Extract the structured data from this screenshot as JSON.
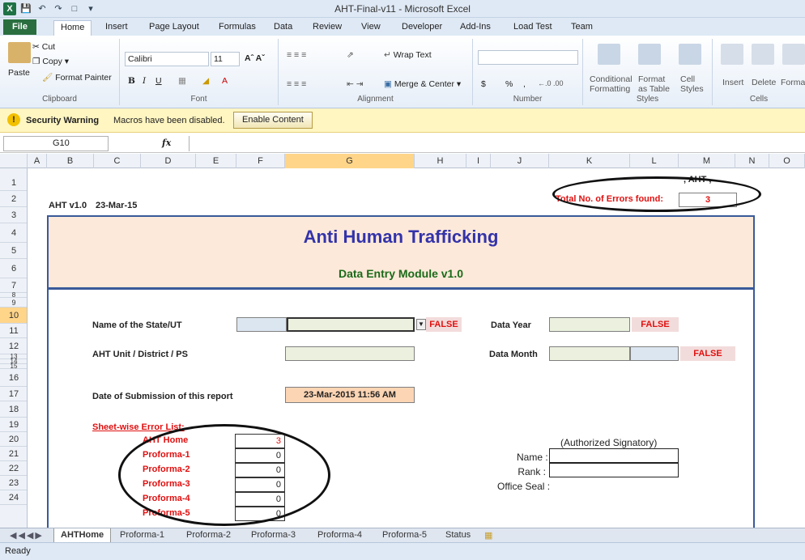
{
  "window": {
    "title": "AHT-Final-v11 - Microsoft Excel"
  },
  "ribbon": {
    "tabs": [
      "File",
      "Home",
      "Insert",
      "Page Layout",
      "Formulas",
      "Data",
      "Review",
      "View",
      "Developer",
      "Add-Ins",
      "Load Test",
      "Team"
    ],
    "active_tab": "Home",
    "clipboard": {
      "paste": "Paste",
      "cut": "Cut",
      "copy": "Copy",
      "format_painter": "Format Painter",
      "label": "Clipboard"
    },
    "font": {
      "name": "Calibri",
      "size": "11",
      "label": "Font"
    },
    "alignment": {
      "wrap": "Wrap Text",
      "merge": "Merge & Center",
      "label": "Alignment"
    },
    "number": {
      "label": "Number",
      "currency": "$",
      "percent": "%",
      "comma": ","
    },
    "styles": {
      "conditional": "Conditional",
      "conditional2": "Formatting",
      "format": "Format",
      "format2": "as Table",
      "cell": "Cell",
      "cell2": "Styles",
      "label": "Styles"
    },
    "cells": {
      "insert": "Insert",
      "delete": "Delete",
      "format": "Forma",
      "label": "Cells"
    }
  },
  "security": {
    "title": "Security Warning",
    "message": "Macros have been disabled.",
    "button": "Enable Content"
  },
  "formula_bar": {
    "name_box": "G10",
    "fx": "fx",
    "value": ""
  },
  "columns": [
    "A",
    "B",
    "C",
    "D",
    "E",
    "F",
    "G",
    "H",
    "I",
    "J",
    "K",
    "L",
    "M",
    "N",
    "O"
  ],
  "selected_column": "G",
  "rows": [
    "1",
    "2",
    "3",
    "4",
    "5",
    "6",
    "7",
    "8",
    "9",
    "10",
    "11",
    "12",
    "13",
    "14",
    "15",
    "16",
    "17",
    "18",
    "19",
    "20",
    "21",
    "22",
    "23",
    "24"
  ],
  "selected_row": "10",
  "sheet": {
    "corner_text": ", AHT-,",
    "version": "AHT v1.0",
    "version_date": "23-Mar-15",
    "total_errors_label": "Total No. of Errors found:",
    "total_errors_value": "3",
    "title": "Anti Human Trafficking",
    "subtitle": "Data Entry Module v1.0",
    "state_label": "Name of the State/UT",
    "state_value": "",
    "state_error": "FALSE",
    "unit_label": "AHT Unit / District / PS",
    "unit_value": "",
    "data_year_label": "Data Year",
    "data_year_error": "FALSE",
    "data_month_label": "Data Month",
    "data_month_error": "FALSE",
    "submission_label": "Date of Submission of this report",
    "submission_value": "23-Mar-2015  11:56 AM",
    "error_list_title": "Sheet-wise Error List:",
    "error_list": [
      {
        "name": "AHT Home",
        "count": "3"
      },
      {
        "name": "Proforma-1",
        "count": "0"
      },
      {
        "name": "Proforma-2",
        "count": "0"
      },
      {
        "name": "Proforma-3",
        "count": "0"
      },
      {
        "name": "Proforma-4",
        "count": "0"
      },
      {
        "name": "Proforma-5",
        "count": "0"
      }
    ],
    "signatory": "(Authorized Signatory)",
    "name_label": "Name :",
    "rank_label": "Rank :",
    "seal_label": "Office Seal :"
  },
  "sheet_tabs": [
    "AHTHome",
    "Proforma-1",
    "Proforma-2",
    "Proforma-3",
    "Proforma-4",
    "Proforma-5",
    "Status"
  ],
  "active_sheet": "AHTHome",
  "status": "Ready"
}
